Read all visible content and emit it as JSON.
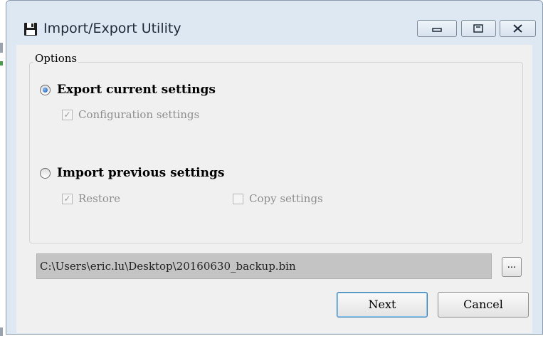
{
  "window": {
    "title": "Import/Export Utility",
    "icon": "floppy-disk-icon",
    "controls": {
      "minimize_icon": "minimize-icon",
      "maximize_icon": "maximize-icon",
      "close_icon": "close-icon"
    }
  },
  "options_group": {
    "label": "Options",
    "export": {
      "label": "Export current settings",
      "selected": true,
      "checkboxes": [
        {
          "label": "Configuration settings",
          "checked": true,
          "enabled": false
        }
      ]
    },
    "import": {
      "label": "Import previous settings",
      "selected": false,
      "checkboxes": [
        {
          "label": "Restore",
          "checked": true,
          "enabled": false
        },
        {
          "label": "Copy settings",
          "checked": false,
          "enabled": false
        }
      ]
    }
  },
  "file": {
    "path": "C:\\Users\\eric.lu\\Desktop\\20160630_backup.bin",
    "browse_label": "..."
  },
  "buttons": {
    "next": "Next",
    "cancel": "Cancel"
  },
  "colors": {
    "frame": "#dde8f3",
    "client": "#f0f0f0",
    "path_field": "#c4c4c4",
    "default_button_border": "#3c7fb1"
  }
}
